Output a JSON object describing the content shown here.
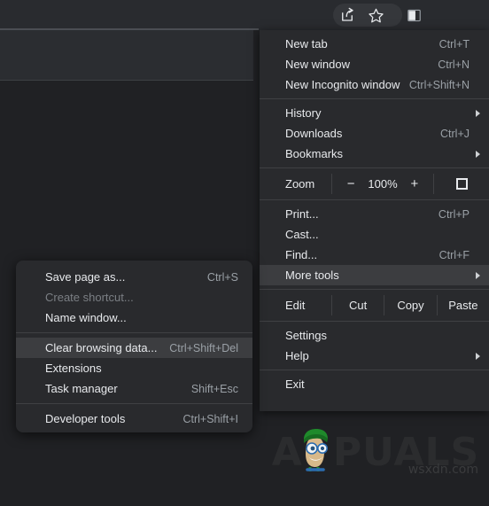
{
  "toolbar": {
    "share_icon": "share-icon",
    "bookmark_icon": "bookmark-star-icon",
    "sidepanel_icon": "side-panel-icon",
    "profile_icon": "profile-avatar-icon",
    "menu_icon": "three-dot-menu-icon"
  },
  "main_menu": {
    "groups": [
      {
        "items": [
          {
            "label": "New tab",
            "shortcut": "Ctrl+T",
            "submenu": false
          },
          {
            "label": "New window",
            "shortcut": "Ctrl+N",
            "submenu": false
          },
          {
            "label": "New Incognito window",
            "shortcut": "Ctrl+Shift+N",
            "submenu": false
          }
        ]
      },
      {
        "items": [
          {
            "label": "History",
            "shortcut": "",
            "submenu": true
          },
          {
            "label": "Downloads",
            "shortcut": "Ctrl+J",
            "submenu": false
          },
          {
            "label": "Bookmarks",
            "shortcut": "",
            "submenu": true
          }
        ]
      },
      {
        "zoom": {
          "label": "Zoom",
          "minus": "−",
          "value": "100%",
          "plus": "+",
          "fullscreen_icon": "fullscreen-icon"
        }
      },
      {
        "items": [
          {
            "label": "Print...",
            "shortcut": "Ctrl+P",
            "submenu": false
          },
          {
            "label": "Cast...",
            "shortcut": "",
            "submenu": false
          },
          {
            "label": "Find...",
            "shortcut": "Ctrl+F",
            "submenu": false
          },
          {
            "label": "More tools",
            "shortcut": "",
            "submenu": true,
            "selected": true
          }
        ]
      },
      {
        "edit": {
          "label": "Edit",
          "cut": "Cut",
          "copy": "Copy",
          "paste": "Paste"
        }
      },
      {
        "items": [
          {
            "label": "Settings",
            "shortcut": "",
            "submenu": false
          },
          {
            "label": "Help",
            "shortcut": "",
            "submenu": true
          }
        ]
      },
      {
        "items": [
          {
            "label": "Exit",
            "shortcut": "",
            "submenu": false
          }
        ]
      }
    ]
  },
  "submenu": {
    "title": "More tools",
    "items": [
      {
        "label": "Save page as...",
        "shortcut": "Ctrl+S",
        "disabled": false,
        "selected": false
      },
      {
        "label": "Create shortcut...",
        "shortcut": "",
        "disabled": true,
        "selected": false
      },
      {
        "label": "Name window...",
        "shortcut": "",
        "disabled": false,
        "selected": false
      },
      {
        "label": "Clear browsing data...",
        "shortcut": "Ctrl+Shift+Del",
        "disabled": false,
        "selected": true
      },
      {
        "label": "Extensions",
        "shortcut": "",
        "disabled": false,
        "selected": false
      },
      {
        "label": "Task manager",
        "shortcut": "Shift+Esc",
        "disabled": false,
        "selected": false
      },
      {
        "label": "Developer tools",
        "shortcut": "Ctrl+Shift+I",
        "disabled": false,
        "selected": false
      }
    ]
  },
  "watermark": {
    "brand_left": "A",
    "brand_right": "PUALS",
    "site_credit": "wsxdn.com"
  },
  "colors": {
    "menu_bg": "#292a2d",
    "menu_text": "#e8eaed",
    "shortcut_text": "#9aa0a6",
    "highlight": "#3c3d40",
    "separator": "#3f4043",
    "page_bg": "#202124",
    "toolbar_bg": "#292b2f"
  }
}
